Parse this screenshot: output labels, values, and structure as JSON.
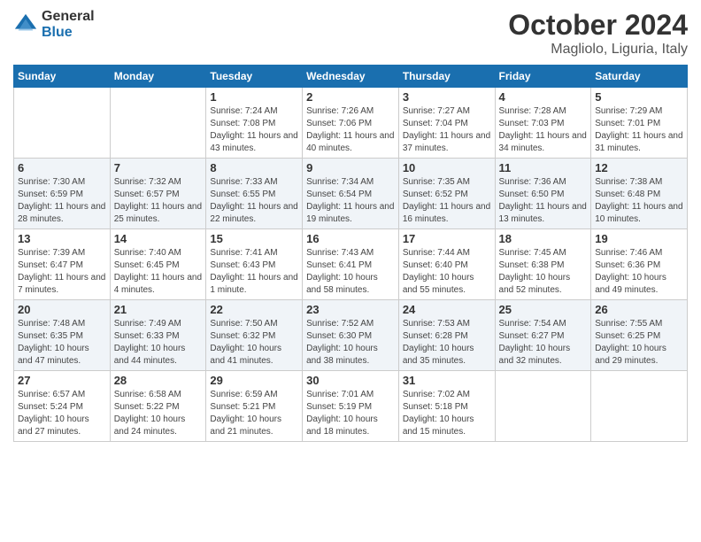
{
  "logo": {
    "general": "General",
    "blue": "Blue"
  },
  "title": "October 2024",
  "location": "Magliolo, Liguria, Italy",
  "days_of_week": [
    "Sunday",
    "Monday",
    "Tuesday",
    "Wednesday",
    "Thursday",
    "Friday",
    "Saturday"
  ],
  "weeks": [
    [
      {
        "day": null
      },
      {
        "day": null
      },
      {
        "day": 1,
        "sunrise": "7:24 AM",
        "sunset": "7:08 PM",
        "daylight": "11 hours and 43 minutes."
      },
      {
        "day": 2,
        "sunrise": "7:26 AM",
        "sunset": "7:06 PM",
        "daylight": "11 hours and 40 minutes."
      },
      {
        "day": 3,
        "sunrise": "7:27 AM",
        "sunset": "7:04 PM",
        "daylight": "11 hours and 37 minutes."
      },
      {
        "day": 4,
        "sunrise": "7:28 AM",
        "sunset": "7:03 PM",
        "daylight": "11 hours and 34 minutes."
      },
      {
        "day": 5,
        "sunrise": "7:29 AM",
        "sunset": "7:01 PM",
        "daylight": "11 hours and 31 minutes."
      }
    ],
    [
      {
        "day": 6,
        "sunrise": "7:30 AM",
        "sunset": "6:59 PM",
        "daylight": "11 hours and 28 minutes."
      },
      {
        "day": 7,
        "sunrise": "7:32 AM",
        "sunset": "6:57 PM",
        "daylight": "11 hours and 25 minutes."
      },
      {
        "day": 8,
        "sunrise": "7:33 AM",
        "sunset": "6:55 PM",
        "daylight": "11 hours and 22 minutes."
      },
      {
        "day": 9,
        "sunrise": "7:34 AM",
        "sunset": "6:54 PM",
        "daylight": "11 hours and 19 minutes."
      },
      {
        "day": 10,
        "sunrise": "7:35 AM",
        "sunset": "6:52 PM",
        "daylight": "11 hours and 16 minutes."
      },
      {
        "day": 11,
        "sunrise": "7:36 AM",
        "sunset": "6:50 PM",
        "daylight": "11 hours and 13 minutes."
      },
      {
        "day": 12,
        "sunrise": "7:38 AM",
        "sunset": "6:48 PM",
        "daylight": "11 hours and 10 minutes."
      }
    ],
    [
      {
        "day": 13,
        "sunrise": "7:39 AM",
        "sunset": "6:47 PM",
        "daylight": "11 hours and 7 minutes."
      },
      {
        "day": 14,
        "sunrise": "7:40 AM",
        "sunset": "6:45 PM",
        "daylight": "11 hours and 4 minutes."
      },
      {
        "day": 15,
        "sunrise": "7:41 AM",
        "sunset": "6:43 PM",
        "daylight": "11 hours and 1 minute."
      },
      {
        "day": 16,
        "sunrise": "7:43 AM",
        "sunset": "6:41 PM",
        "daylight": "10 hours and 58 minutes."
      },
      {
        "day": 17,
        "sunrise": "7:44 AM",
        "sunset": "6:40 PM",
        "daylight": "10 hours and 55 minutes."
      },
      {
        "day": 18,
        "sunrise": "7:45 AM",
        "sunset": "6:38 PM",
        "daylight": "10 hours and 52 minutes."
      },
      {
        "day": 19,
        "sunrise": "7:46 AM",
        "sunset": "6:36 PM",
        "daylight": "10 hours and 49 minutes."
      }
    ],
    [
      {
        "day": 20,
        "sunrise": "7:48 AM",
        "sunset": "6:35 PM",
        "daylight": "10 hours and 47 minutes."
      },
      {
        "day": 21,
        "sunrise": "7:49 AM",
        "sunset": "6:33 PM",
        "daylight": "10 hours and 44 minutes."
      },
      {
        "day": 22,
        "sunrise": "7:50 AM",
        "sunset": "6:32 PM",
        "daylight": "10 hours and 41 minutes."
      },
      {
        "day": 23,
        "sunrise": "7:52 AM",
        "sunset": "6:30 PM",
        "daylight": "10 hours and 38 minutes."
      },
      {
        "day": 24,
        "sunrise": "7:53 AM",
        "sunset": "6:28 PM",
        "daylight": "10 hours and 35 minutes."
      },
      {
        "day": 25,
        "sunrise": "7:54 AM",
        "sunset": "6:27 PM",
        "daylight": "10 hours and 32 minutes."
      },
      {
        "day": 26,
        "sunrise": "7:55 AM",
        "sunset": "6:25 PM",
        "daylight": "10 hours and 29 minutes."
      }
    ],
    [
      {
        "day": 27,
        "sunrise": "6:57 AM",
        "sunset": "5:24 PM",
        "daylight": "10 hours and 27 minutes."
      },
      {
        "day": 28,
        "sunrise": "6:58 AM",
        "sunset": "5:22 PM",
        "daylight": "10 hours and 24 minutes."
      },
      {
        "day": 29,
        "sunrise": "6:59 AM",
        "sunset": "5:21 PM",
        "daylight": "10 hours and 21 minutes."
      },
      {
        "day": 30,
        "sunrise": "7:01 AM",
        "sunset": "5:19 PM",
        "daylight": "10 hours and 18 minutes."
      },
      {
        "day": 31,
        "sunrise": "7:02 AM",
        "sunset": "5:18 PM",
        "daylight": "10 hours and 15 minutes."
      },
      {
        "day": null
      },
      {
        "day": null
      }
    ]
  ],
  "labels": {
    "sunrise": "Sunrise:",
    "sunset": "Sunset:",
    "daylight": "Daylight:"
  }
}
